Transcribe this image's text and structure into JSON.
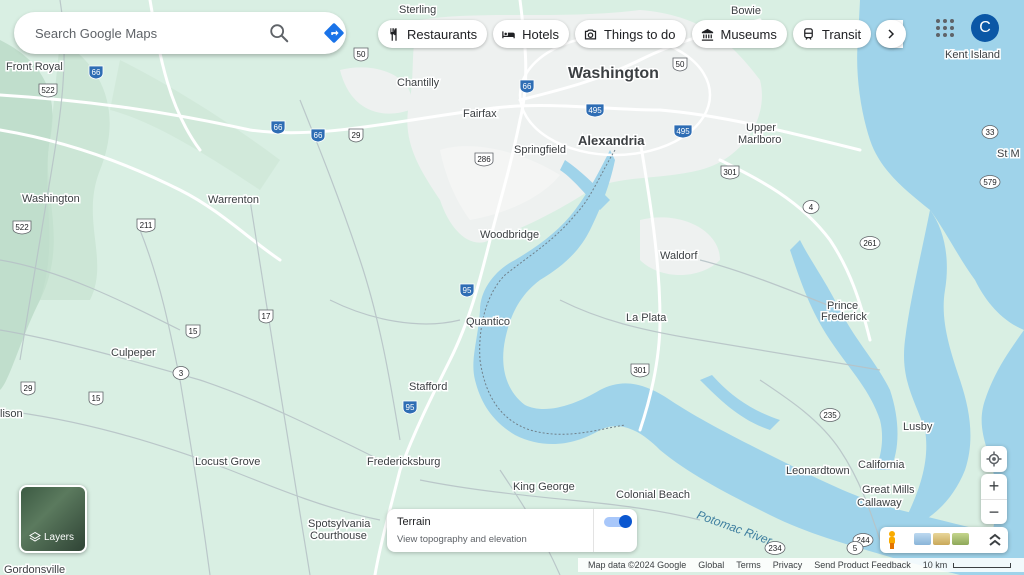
{
  "search": {
    "placeholder": "Search Google Maps"
  },
  "chips": [
    {
      "label": "Restaurants",
      "icon": "fork-knife-icon"
    },
    {
      "label": "Hotels",
      "icon": "bed-icon"
    },
    {
      "label": "Things to do",
      "icon": "camera-icon"
    },
    {
      "label": "Museums",
      "icon": "museum-icon"
    },
    {
      "label": "Transit",
      "icon": "train-icon"
    }
  ],
  "account": {
    "initial": "C"
  },
  "layers": {
    "label": "Layers"
  },
  "terrain": {
    "title": "Terrain",
    "subtitle": "View topography and elevation",
    "enabled": true
  },
  "footer": {
    "map_data": "Map data ©2024 Google",
    "global": "Global",
    "terms": "Terms",
    "privacy": "Privacy",
    "feedback": "Send Product Feedback",
    "scale": "10 km"
  },
  "places": {
    "washington_dc": "Washington",
    "alexandria": "Alexandria",
    "sterling": "Sterling",
    "bowie": "Bowie",
    "front_royal": "Front Royal",
    "chantilly": "Chantilly",
    "fairfax": "Fairfax",
    "kent_island": "Kent Island",
    "springfield": "Springfield",
    "upper_marlboro": "Upper\nMarlboro",
    "upper": "Upper",
    "marlboro": "Marlboro",
    "st_m": "St M",
    "washington_va": "Washington",
    "warrenton": "Warrenton",
    "woodbridge": "Woodbridge",
    "waldorf": "Waldorf",
    "quantico": "Quantico",
    "la_plata": "La Plata",
    "prince": "Prince",
    "frederick": "Frederick",
    "culpeper": "Culpeper",
    "stafford": "Stafford",
    "lison": "lison",
    "lusby": "Lusby",
    "locust_grove": "Locust Grove",
    "fredericksburg": "Fredericksburg",
    "leonardtown": "Leonardtown",
    "california": "California",
    "king_george": "King George",
    "colonial_beach": "Colonial Beach",
    "great_mills": "Great Mills",
    "callaway": "Callaway",
    "spotsylvania": "Spotsylvania",
    "courthouse": "Courthouse",
    "gordonsville": "Gordonsville",
    "potomac_river": "Potomac River"
  },
  "route_shields": [
    "66",
    "50",
    "66",
    "50",
    "495",
    "495",
    "29",
    "66",
    "66",
    "286",
    "522",
    "211",
    "301",
    "4",
    "33",
    "579",
    "522",
    "261",
    "95",
    "15",
    "17",
    "29",
    "3",
    "301",
    "15",
    "95",
    "235",
    "244",
    "234",
    "5"
  ]
}
